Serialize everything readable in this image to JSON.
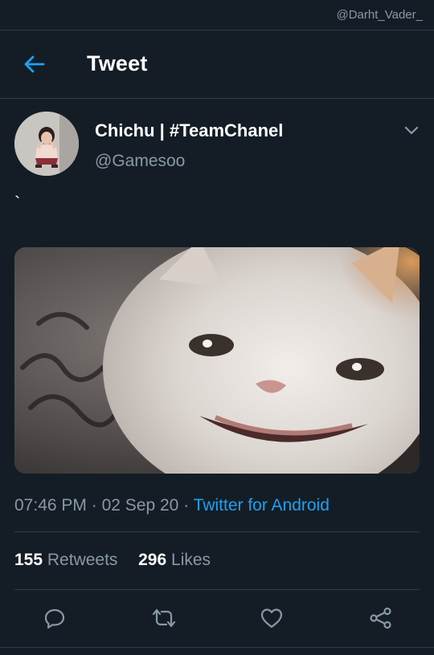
{
  "watermark": "@Darht_Vader_",
  "header": {
    "title": "Tweet",
    "back_icon": "arrow-left-icon"
  },
  "author": {
    "name": "Chichu | #TeamChanel",
    "handle": "@Gamesoo",
    "menu_icon": "chevron-down-icon"
  },
  "tweet": {
    "text": "`",
    "image_alt": "crying cat photo",
    "time": "07:46 PM",
    "date": "02 Sep 20",
    "separator": "·",
    "source": "Twitter for Android"
  },
  "stats": {
    "retweets_count": "155",
    "retweets_label": "Retweets",
    "likes_count": "296",
    "likes_label": "Likes"
  },
  "actions": {
    "reply_icon": "reply-icon",
    "retweet_icon": "retweet-icon",
    "like_icon": "heart-icon",
    "share_icon": "share-icon"
  },
  "colors": {
    "background": "#141d26",
    "accent": "#1da1f2",
    "muted_text": "#8899a6",
    "divider": "#2f3b47"
  }
}
